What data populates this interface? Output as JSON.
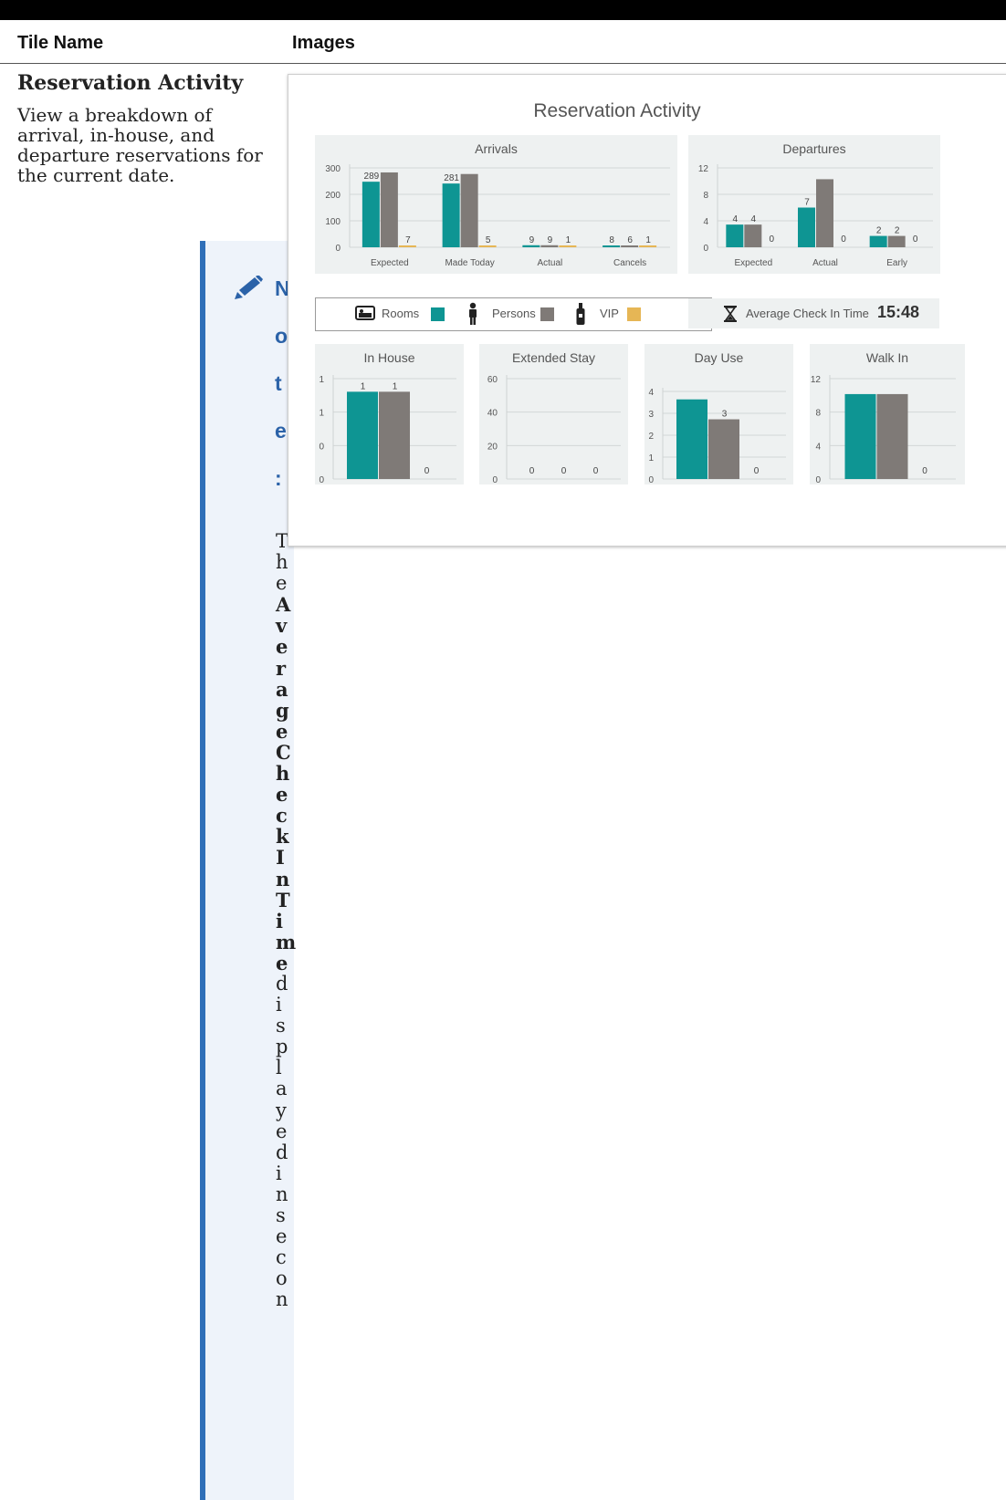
{
  "table": {
    "headers": {
      "tile_name": "Tile Name",
      "images": "Images"
    },
    "row": {
      "tile_title": "Reservation Activity",
      "tile_description": "View a breakdown of arrival, in-house, and departure reservations for the current date."
    }
  },
  "note": {
    "heading_letters": [
      "N",
      "o",
      "t",
      "e",
      ":"
    ],
    "icon": "pencil-icon",
    "body_letters": [
      {
        "c": "T",
        "bold": false
      },
      {
        "c": "h",
        "bold": false
      },
      {
        "c": "e",
        "bold": false
      },
      {
        "c": "A",
        "bold": true
      },
      {
        "c": "v",
        "bold": true
      },
      {
        "c": "e",
        "bold": true
      },
      {
        "c": "r",
        "bold": true
      },
      {
        "c": "a",
        "bold": true
      },
      {
        "c": "g",
        "bold": true
      },
      {
        "c": "e",
        "bold": true
      },
      {
        "c": "C",
        "bold": true
      },
      {
        "c": "h",
        "bold": true
      },
      {
        "c": "e",
        "bold": true
      },
      {
        "c": "c",
        "bold": true
      },
      {
        "c": "k",
        "bold": true
      },
      {
        "c": "I",
        "bold": true
      },
      {
        "c": "n",
        "bold": true
      },
      {
        "c": "T",
        "bold": true
      },
      {
        "c": "i",
        "bold": true
      },
      {
        "c": "m",
        "bold": true
      },
      {
        "c": "e",
        "bold": true
      },
      {
        "c": "d",
        "bold": false
      },
      {
        "c": "i",
        "bold": false
      },
      {
        "c": "s",
        "bold": false
      },
      {
        "c": "p",
        "bold": false
      },
      {
        "c": "l",
        "bold": false
      },
      {
        "c": "a",
        "bold": false
      },
      {
        "c": "y",
        "bold": false
      },
      {
        "c": "e",
        "bold": false
      },
      {
        "c": "d",
        "bold": false
      },
      {
        "c": "i",
        "bold": false
      },
      {
        "c": "n",
        "bold": false
      },
      {
        "c": "s",
        "bold": false
      },
      {
        "c": "e",
        "bold": false
      },
      {
        "c": "c",
        "bold": false
      },
      {
        "c": "o",
        "bold": false
      },
      {
        "c": "n",
        "bold": false
      }
    ]
  },
  "screenshot": {
    "title": "Reservation Activity",
    "colors": {
      "rooms": "#0e9593",
      "persons": "#7f7a77",
      "vip": "#e6b655"
    },
    "legend": {
      "rooms_label": "Rooms",
      "persons_label": "Persons",
      "vip_label": "VIP",
      "rooms_icon": "bed-icon",
      "persons_icon": "person-icon",
      "vip_icon": "bottle-icon"
    },
    "average_check_in": {
      "label": "Average Check In Time",
      "value": "15:48",
      "icon": "hourglass-icon"
    }
  },
  "chart_data": [
    {
      "id": "arrivals",
      "type": "bar",
      "title": "Arrivals",
      "categories": [
        "Expected",
        "Made Today",
        "Actual",
        "Cancels"
      ],
      "yticks": [
        "0",
        "100",
        "200",
        "300"
      ],
      "ylim": [
        0,
        350
      ],
      "series": [
        {
          "key": "rooms",
          "values": [
            289,
            281,
            9,
            8
          ],
          "labels": [
            "289",
            "281",
            "9",
            "8"
          ]
        },
        {
          "key": "persons",
          "values": [
            330,
            323,
            9,
            6
          ],
          "labels": [
            "",
            "",
            "9",
            "6"
          ]
        },
        {
          "key": "vip",
          "values": [
            7,
            5,
            1,
            1
          ],
          "labels": [
            "7",
            "5",
            "1",
            "1"
          ]
        }
      ]
    },
    {
      "id": "departures",
      "type": "bar",
      "title": "Departures",
      "categories": [
        "Expected",
        "Actual",
        "Early"
      ],
      "yticks": [
        "0",
        "4",
        "8",
        "12"
      ],
      "ylim": [
        0,
        14
      ],
      "series": [
        {
          "key": "rooms",
          "values": [
            4,
            7,
            2
          ],
          "labels": [
            "4",
            "7",
            "2"
          ]
        },
        {
          "key": "persons",
          "values": [
            4,
            12,
            2
          ],
          "labels": [
            "4",
            "",
            "2"
          ]
        },
        {
          "key": "vip",
          "values": [
            0,
            0,
            0
          ],
          "labels": [
            "0",
            "0",
            "0"
          ]
        }
      ]
    },
    {
      "id": "in_house",
      "type": "bar",
      "title": "In House",
      "categories": [
        ""
      ],
      "yticks": [
        "0",
        "0",
        "1",
        "1"
      ],
      "ylim": [
        0,
        1.15
      ],
      "series": [
        {
          "key": "rooms",
          "values": [
            1
          ],
          "labels": [
            "1"
          ]
        },
        {
          "key": "persons",
          "values": [
            1
          ],
          "labels": [
            "1"
          ]
        },
        {
          "key": "vip",
          "values": [
            0
          ],
          "labels": [
            "0"
          ]
        }
      ]
    },
    {
      "id": "extended_stay",
      "type": "bar",
      "title": "Extended Stay",
      "categories": [
        ""
      ],
      "yticks": [
        "0",
        "20",
        "40",
        "60"
      ],
      "ylim": [
        0,
        60
      ],
      "series": [
        {
          "key": "rooms",
          "values": [
            0
          ],
          "labels": [
            "0"
          ]
        },
        {
          "key": "persons",
          "values": [
            0
          ],
          "labels": [
            "0"
          ]
        },
        {
          "key": "vip",
          "values": [
            0
          ],
          "labels": [
            "0"
          ]
        }
      ]
    },
    {
      "id": "day_use",
      "type": "bar",
      "title": "Day Use",
      "categories": [
        ""
      ],
      "yticks": [
        "0",
        "1",
        "2",
        "3",
        "4"
      ],
      "ylim": [
        0,
        4.4
      ],
      "series": [
        {
          "key": "rooms",
          "values": [
            4
          ],
          "labels": [
            ""
          ]
        },
        {
          "key": "persons",
          "values": [
            3
          ],
          "labels": [
            "3"
          ]
        },
        {
          "key": "vip",
          "values": [
            0
          ],
          "labels": [
            "0"
          ]
        }
      ]
    },
    {
      "id": "walk_in",
      "type": "bar",
      "title": "Walk In",
      "categories": [
        ""
      ],
      "yticks": [
        "0",
        "4",
        "8",
        "12"
      ],
      "ylim": [
        0,
        13
      ],
      "series": [
        {
          "key": "rooms",
          "values": [
            11
          ],
          "labels": [
            ""
          ]
        },
        {
          "key": "persons",
          "values": [
            11
          ],
          "labels": [
            ""
          ]
        },
        {
          "key": "vip",
          "values": [
            0
          ],
          "labels": [
            "0"
          ]
        }
      ]
    }
  ]
}
